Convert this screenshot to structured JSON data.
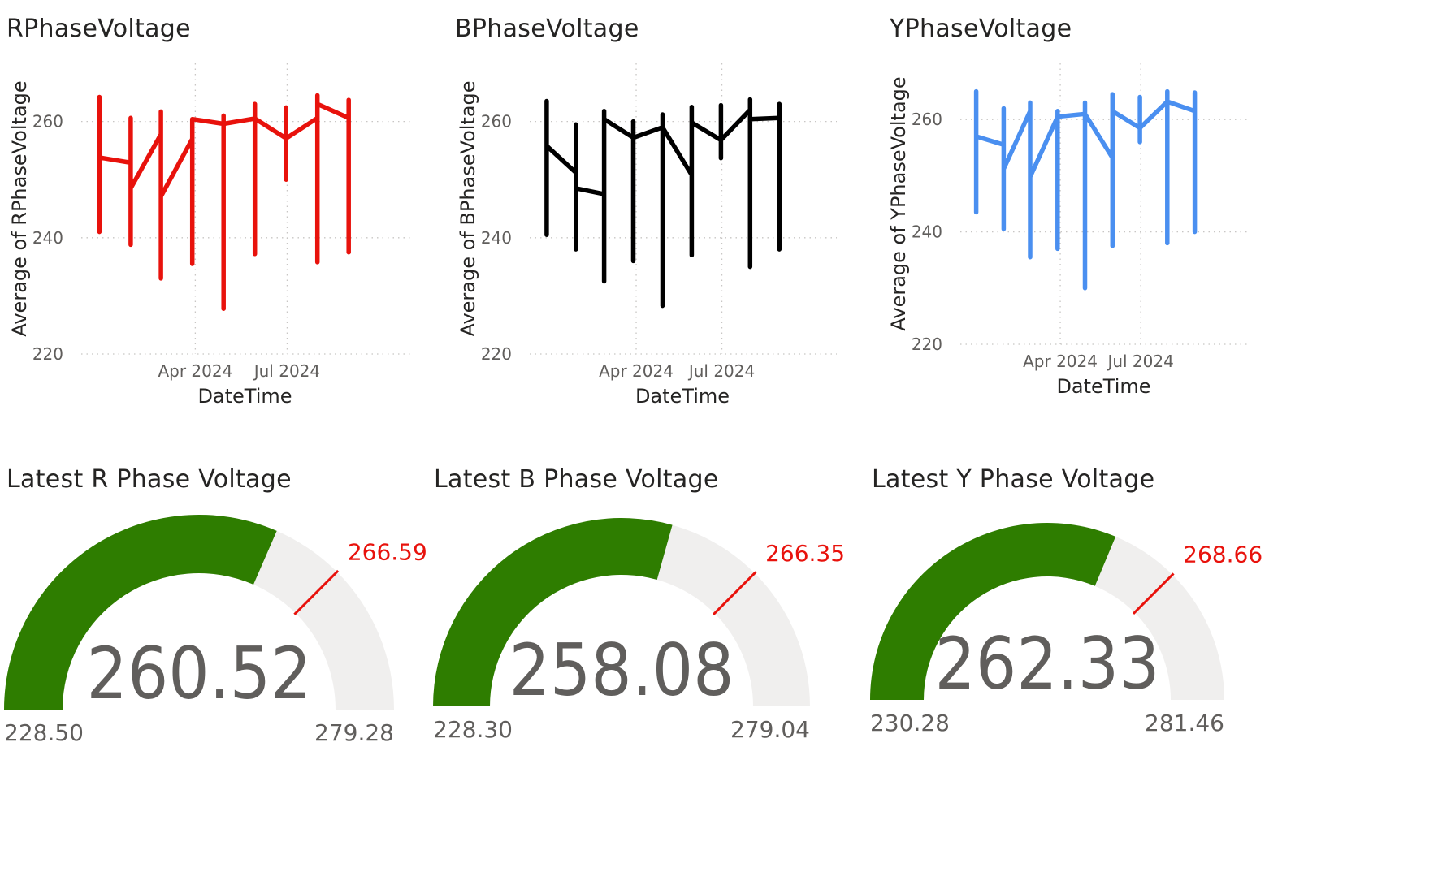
{
  "line_charts": [
    {
      "title": "RPhaseVoltage",
      "xlabel": "DateTime",
      "ylabel": "Average of RPhaseVoltage",
      "color": "#e8120c"
    },
    {
      "title": "BPhaseVoltage",
      "xlabel": "DateTime",
      "ylabel": "Average of BPhaseVoltage",
      "color": "#000000"
    },
    {
      "title": "YPhaseVoltage",
      "xlabel": "DateTime",
      "ylabel": "Average of YPhaseVoltage",
      "color": "#4a8ff0"
    }
  ],
  "gauges": [
    {
      "title": "Latest R Phase Voltage",
      "value": "260.52",
      "min": "228.50",
      "max": "279.28",
      "target": "266.59",
      "fill_color": "#2e7d00",
      "track_color": "#f0efee",
      "target_color": "#e8120c"
    },
    {
      "title": "Latest B Phase Voltage",
      "value": "258.08",
      "min": "228.30",
      "max": "279.04",
      "target": "266.35",
      "fill_color": "#2e7d00",
      "track_color": "#f0efee",
      "target_color": "#e8120c"
    },
    {
      "title": "Latest Y Phase Voltage",
      "value": "262.33",
      "min": "230.28",
      "max": "281.46",
      "target": "268.66",
      "fill_color": "#2e7d00",
      "track_color": "#f0efee",
      "target_color": "#e8120c"
    }
  ],
  "chart_data": [
    {
      "type": "line",
      "title": "RPhaseVoltage",
      "xlabel": "DateTime",
      "ylabel": "Average of RPhaseVoltage",
      "x_ticks": [
        {
          "label": "Apr 2024",
          "x": "2024-04-01"
        },
        {
          "label": "Jul 2024",
          "x": "2024-07-01"
        }
      ],
      "y_ticks": [
        220,
        240,
        260
      ],
      "ylim": [
        220,
        270
      ],
      "xlim": [
        "2023-12-10",
        "2024-10-31"
      ],
      "grid": true,
      "series": [
        {
          "points": [
            [
              "2023-12-28",
              264.2
            ],
            [
              "2023-12-28",
              241.0
            ],
            [
              "2023-12-28",
              253.8
            ],
            [
              "2024-01-28",
              252.9
            ],
            [
              "2024-01-28",
              260.6
            ],
            [
              "2024-01-28",
              238.8
            ],
            [
              "2024-01-28",
              248.5
            ],
            [
              "2024-02-27",
              257.8
            ],
            [
              "2024-02-27",
              261.7
            ],
            [
              "2024-02-27",
              233.0
            ],
            [
              "2024-02-27",
              247.1
            ],
            [
              "2024-03-29",
              257.0
            ],
            [
              "2024-03-29",
              235.5
            ],
            [
              "2024-03-29",
              260.4
            ],
            [
              "2024-04-29",
              259.6
            ],
            [
              "2024-04-29",
              261.0
            ],
            [
              "2024-04-29",
              227.8
            ],
            [
              "2024-04-29",
              259.6
            ],
            [
              "2024-05-30",
              260.5
            ],
            [
              "2024-05-30",
              263.0
            ],
            [
              "2024-05-30",
              237.2
            ],
            [
              "2024-05-30",
              260.5
            ],
            [
              "2024-06-30",
              257.1
            ],
            [
              "2024-06-30",
              262.4
            ],
            [
              "2024-06-30",
              250.0
            ],
            [
              "2024-06-30",
              257.1
            ],
            [
              "2024-07-31",
              260.6
            ],
            [
              "2024-07-31",
              264.5
            ],
            [
              "2024-07-31",
              235.8
            ],
            [
              "2024-07-31",
              263.0
            ],
            [
              "2024-08-31",
              260.6
            ],
            [
              "2024-08-31",
              263.7
            ],
            [
              "2024-08-31",
              237.5
            ]
          ]
        }
      ]
    },
    {
      "type": "line",
      "title": "BPhaseVoltage",
      "xlabel": "DateTime",
      "ylabel": "Average of BPhaseVoltage",
      "x_ticks": [
        {
          "label": "Apr 2024",
          "x": "2024-04-01"
        },
        {
          "label": "Jul 2024",
          "x": "2024-07-01"
        }
      ],
      "y_ticks": [
        220,
        240,
        260
      ],
      "ylim": [
        220,
        270
      ],
      "xlim": [
        "2023-12-10",
        "2024-10-31"
      ],
      "grid": true,
      "series": [
        {
          "points": [
            [
              "2023-12-28",
              263.5
            ],
            [
              "2023-12-28",
              240.5
            ],
            [
              "2023-12-28",
              255.8
            ],
            [
              "2024-01-28",
              251.2
            ],
            [
              "2024-01-28",
              259.5
            ],
            [
              "2024-01-28",
              238.0
            ],
            [
              "2024-01-28",
              248.5
            ],
            [
              "2024-02-27",
              247.5
            ],
            [
              "2024-02-27",
              232.5
            ],
            [
              "2024-02-27",
              261.8
            ],
            [
              "2024-02-27",
              260.4
            ],
            [
              "2024-03-29",
              257.2
            ],
            [
              "2024-03-29",
              236.0
            ],
            [
              "2024-03-29",
              260.0
            ],
            [
              "2024-03-29",
              257.2
            ],
            [
              "2024-04-29",
              259.0
            ],
            [
              "2024-04-29",
              228.3
            ],
            [
              "2024-04-29",
              261.2
            ],
            [
              "2024-04-29",
              259.0
            ],
            [
              "2024-05-30",
              250.8
            ],
            [
              "2024-05-30",
              237.0
            ],
            [
              "2024-05-30",
              262.5
            ],
            [
              "2024-05-30",
              259.8
            ],
            [
              "2024-06-30",
              256.8
            ],
            [
              "2024-06-30",
              253.7
            ],
            [
              "2024-06-30",
              262.8
            ],
            [
              "2024-06-30",
              256.8
            ],
            [
              "2024-07-31",
              262.0
            ],
            [
              "2024-07-31",
              235.0
            ],
            [
              "2024-07-31",
              263.8
            ],
            [
              "2024-07-31",
              260.4
            ],
            [
              "2024-08-31",
              260.6
            ],
            [
              "2024-08-31",
              238.0
            ],
            [
              "2024-08-31",
              263.0
            ]
          ]
        }
      ]
    },
    {
      "type": "line",
      "title": "YPhaseVoltage",
      "xlabel": "DateTime",
      "ylabel": "Average of YPhaseVoltage",
      "x_ticks": [
        {
          "label": "Apr 2024",
          "x": "2024-04-01"
        },
        {
          "label": "Jul 2024",
          "x": "2024-07-01"
        }
      ],
      "y_ticks": [
        220,
        240,
        260
      ],
      "ylim": [
        220,
        270
      ],
      "xlim": [
        "2023-12-10",
        "2024-10-31"
      ],
      "grid": true,
      "series": [
        {
          "points": [
            [
              "2023-12-28",
              265.0
            ],
            [
              "2023-12-28",
              243.5
            ],
            [
              "2023-12-28",
              257.0
            ],
            [
              "2024-01-28",
              255.5
            ],
            [
              "2024-01-28",
              262.0
            ],
            [
              "2024-01-28",
              240.5
            ],
            [
              "2024-01-28",
              251.2
            ],
            [
              "2024-02-27",
              261.5
            ],
            [
              "2024-02-27",
              263.0
            ],
            [
              "2024-02-27",
              235.5
            ],
            [
              "2024-02-27",
              249.8
            ],
            [
              "2024-03-29",
              260.5
            ],
            [
              "2024-03-29",
              261.5
            ],
            [
              "2024-03-29",
              237.0
            ],
            [
              "2024-03-29",
              260.5
            ],
            [
              "2024-04-29",
              261.0
            ],
            [
              "2024-04-29",
              263.0
            ],
            [
              "2024-04-29",
              230.0
            ],
            [
              "2024-04-29",
              261.0
            ],
            [
              "2024-05-30",
              253.2
            ],
            [
              "2024-05-30",
              237.5
            ],
            [
              "2024-05-30",
              264.5
            ],
            [
              "2024-05-30",
              261.5
            ],
            [
              "2024-06-30",
              258.5
            ],
            [
              "2024-06-30",
              256.0
            ],
            [
              "2024-06-30",
              264.0
            ],
            [
              "2024-06-30",
              258.5
            ],
            [
              "2024-07-31",
              263.2
            ],
            [
              "2024-07-31",
              238.0
            ],
            [
              "2024-07-31",
              265.0
            ],
            [
              "2024-07-31",
              263.2
            ],
            [
              "2024-08-31",
              261.5
            ],
            [
              "2024-08-31",
              240.0
            ],
            [
              "2024-08-31",
              264.8
            ]
          ]
        }
      ]
    }
  ]
}
